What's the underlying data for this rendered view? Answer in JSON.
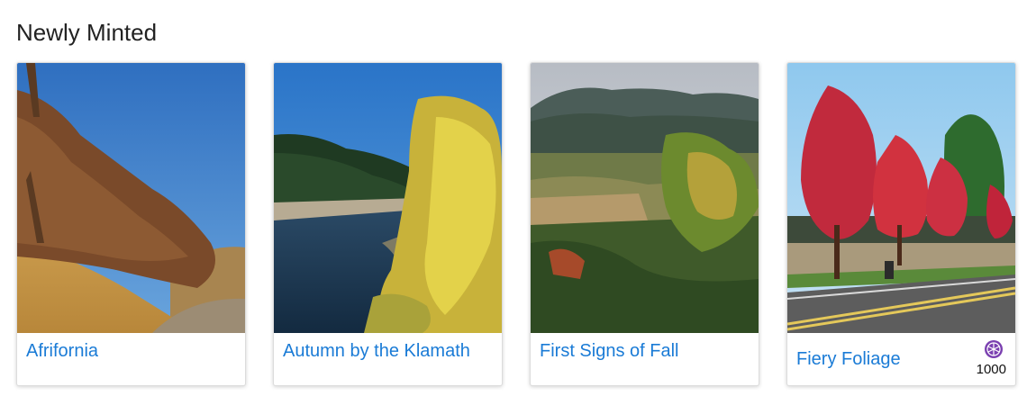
{
  "section": {
    "title": "Newly Minted"
  },
  "cards": [
    {
      "title": "Afrifornia",
      "image_icon": "landscape-photo"
    },
    {
      "title": "Autumn by the Klamath",
      "image_icon": "landscape-photo"
    },
    {
      "title": "First Signs of Fall",
      "image_icon": "landscape-photo"
    },
    {
      "title": "Fiery Foliage",
      "image_icon": "landscape-photo",
      "price": "1000",
      "price_icon": "coin-icon"
    }
  ],
  "colors": {
    "link": "#1a7bd6",
    "coin": "#7a3fb0"
  }
}
